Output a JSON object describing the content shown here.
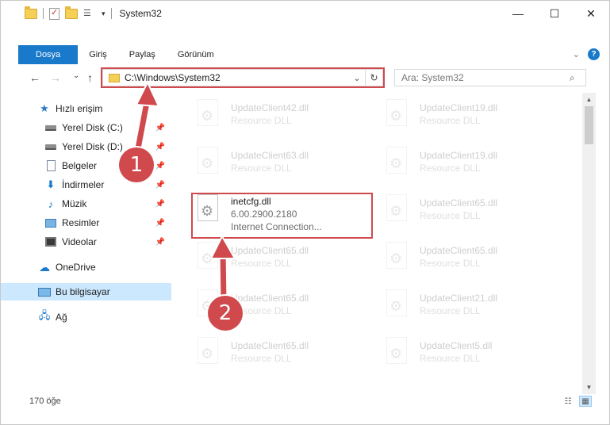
{
  "window": {
    "title": "System32",
    "minimize_glyph": "—",
    "maximize_glyph": "☐",
    "close_glyph": "✕"
  },
  "ribbon": {
    "tabs": [
      {
        "label": "Dosya"
      },
      {
        "label": "Giriş"
      },
      {
        "label": "Paylaş"
      },
      {
        "label": "Görünüm"
      }
    ],
    "help_glyph": "?",
    "expand_glyph": "⌄"
  },
  "nav": {
    "back_glyph": "←",
    "forward_glyph": "→",
    "recent_glyph": "⌄",
    "up_glyph": "↑",
    "address": "C:\\Windows\\System32",
    "address_chevron": "⌄",
    "refresh_glyph": "↻",
    "search_placeholder": "Ara: System32",
    "search_glyph": "⌕"
  },
  "sidebar": {
    "pin_glyph": "📌",
    "items": [
      {
        "label": "Hızlı erişim",
        "icon": "quick-access-icon"
      },
      {
        "label": "Yerel Disk (C:)",
        "icon": "drive-icon"
      },
      {
        "label": "Yerel Disk (D:)",
        "icon": "drive-icon"
      },
      {
        "label": "Belgeler",
        "icon": "documents-icon"
      },
      {
        "label": "İndirmeler",
        "icon": "downloads-icon"
      },
      {
        "label": "Müzik",
        "icon": "music-icon"
      },
      {
        "label": "Resimler",
        "icon": "pictures-icon"
      },
      {
        "label": "Videolar",
        "icon": "videos-icon"
      },
      {
        "label": "OneDrive",
        "icon": "onedrive-icon"
      },
      {
        "label": "Bu bilgisayar",
        "icon": "this-pc-icon"
      },
      {
        "label": "Ağ",
        "icon": "network-icon"
      }
    ]
  },
  "files": {
    "left": [
      {
        "name": "UpdateClient42.dll",
        "desc": "Resource DLL"
      },
      {
        "name": "UpdateClient63.dll",
        "desc": "Resource DLL"
      },
      {
        "name": "inetcfg.dll",
        "version": "6.00.2900.2180",
        "desc": "Internet Connection..."
      },
      {
        "name": "UpdateClient65.dll",
        "desc": "Resource DLL"
      },
      {
        "name": "UpdateClient65.dll",
        "desc": "Resource DLL"
      },
      {
        "name": "UpdateClient65.dll",
        "desc": "Resource DLL"
      }
    ],
    "right": [
      {
        "name": "UpdateClient19.dll",
        "desc": "Resource DLL"
      },
      {
        "name": "UpdateClient19.dll",
        "desc": "Resource DLL"
      },
      {
        "name": "UpdateClient65.dll",
        "desc": "Resource DLL"
      },
      {
        "name": "UpdateClient65.dll",
        "desc": "Resource DLL"
      },
      {
        "name": "UpdateClient21.dll",
        "desc": "Resource DLL"
      },
      {
        "name": "UpdateClient5.dll",
        "desc": "Resource DLL"
      }
    ]
  },
  "status": {
    "item_count": "170 öğe"
  },
  "callouts": {
    "step1": "1",
    "step2": "2",
    "color": "#d0494d"
  }
}
